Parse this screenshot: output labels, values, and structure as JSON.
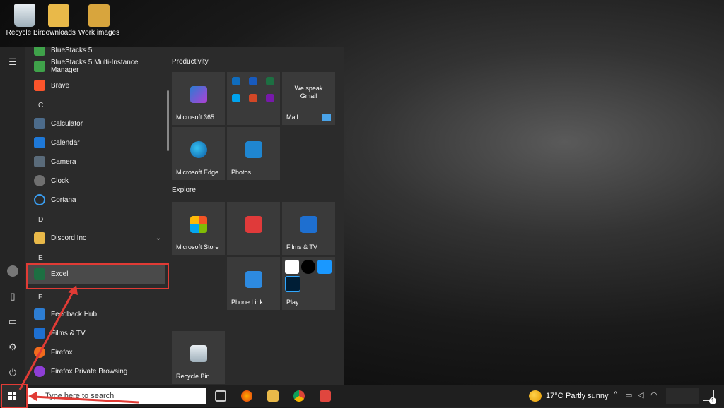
{
  "desktop": {
    "icons": [
      {
        "label": "Recycle Bin",
        "icon": "recycle-bin-icon"
      },
      {
        "label": "downloads",
        "icon": "folder-icon"
      },
      {
        "label": "Work images",
        "icon": "folder-icon"
      }
    ]
  },
  "start_menu": {
    "apps_top": [
      "BlueStacks 5",
      "BlueStacks 5 Multi-Instance Manager",
      "Brave"
    ],
    "letter_c": "C",
    "apps_c": [
      "Calculator",
      "Calendar",
      "Camera",
      "Clock",
      "Cortana"
    ],
    "letter_d": "D",
    "apps_d": [
      "Discord Inc"
    ],
    "letter_e": "E",
    "apps_e": [
      "Excel"
    ],
    "letter_f": "F",
    "apps_f": [
      "Feedback Hub",
      "Films & TV",
      "Firefox",
      "Firefox Private Browsing"
    ],
    "groups": {
      "productivity": "Productivity",
      "explore": "Explore"
    },
    "tiles": {
      "m365": "Microsoft 365...",
      "mail_promo": "We speak Gmail",
      "mail": "Mail",
      "edge": "Microsoft Edge",
      "photos": "Photos",
      "store": "Microsoft Store",
      "films": "Films & TV",
      "phone": "Phone Link",
      "play": "Play",
      "recycle": "Recycle Bin"
    }
  },
  "taskbar": {
    "search_placeholder": "Type here to search",
    "temperature": "17°C",
    "weather": "Partly sunny",
    "notification_count": "1"
  },
  "colors": {
    "accent_red": "#e13b35",
    "excel_green": "#1d6f42"
  }
}
